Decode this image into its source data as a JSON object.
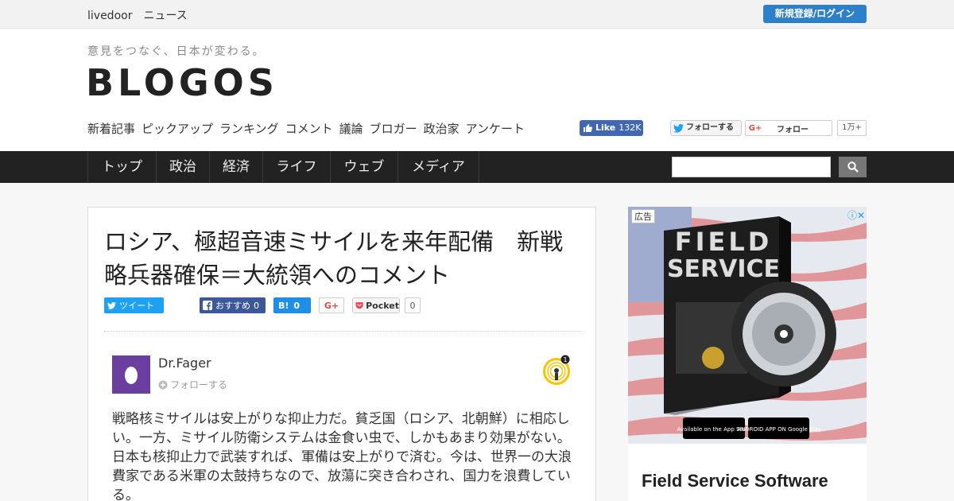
{
  "topbar": {
    "brand": "livedoor　ニュース",
    "login_label": "新規登録/ログイン"
  },
  "header": {
    "tagline": "意見をつなぐ、日本が変わる。",
    "logo": "BLOGOS",
    "subnav": [
      "新着記事",
      "ピックアップ",
      "ランキング",
      "コメント",
      "議論",
      "ブロガー",
      "政治家",
      "アンケート"
    ],
    "fb_like": {
      "label": "Like",
      "count": "132K"
    },
    "tw_follow_label": "フォローする",
    "g_follow_label": "フォロー",
    "g_count": "1万+"
  },
  "nav": {
    "items": [
      "トップ",
      "政治",
      "経済",
      "ライフ",
      "ウェブ",
      "メディア"
    ],
    "search_placeholder": ""
  },
  "article": {
    "title": "ロシア、極超音速ミサイルを来年配備　新戦略兵器確保＝大統領へのコメント",
    "share": {
      "tweet_label": "ツイート",
      "fb_label": "おすすめ",
      "fb_count": "0",
      "hatena_label": "B!",
      "hatena_count": "0",
      "gplus_label": "G+",
      "pocket_label": "Pocket",
      "pocket_count": "0"
    },
    "author": "Dr.Fager",
    "follow_label": "フォローする",
    "badge_count": "1",
    "body": "戦略核ミサイルは安上がりな抑止力だ。貧乏国（ロシア、北朝鮮）に相応しい。一方、ミサイル防衛システムは金食い虫で、しかもあまり効果がない。日本も核抑止力で武装すれば、軍備は安上がりで済む。今は、世界一の大浪費家である米軍の太鼓持ちなので、放蕩に突き合わされ、国力を浪費している。"
  },
  "ad": {
    "label": "広告",
    "image_text_1": "FIELD",
    "image_text_2": "SERVICE",
    "app_store": "Available on the App Store",
    "google_play": "ANDROID APP ON Google play",
    "title": "Field Service Software"
  },
  "colors": {
    "accent": "#2c7fc8",
    "nav_bg": "#222222",
    "facebook": "#3b5998",
    "twitter": "#1da1f2"
  }
}
